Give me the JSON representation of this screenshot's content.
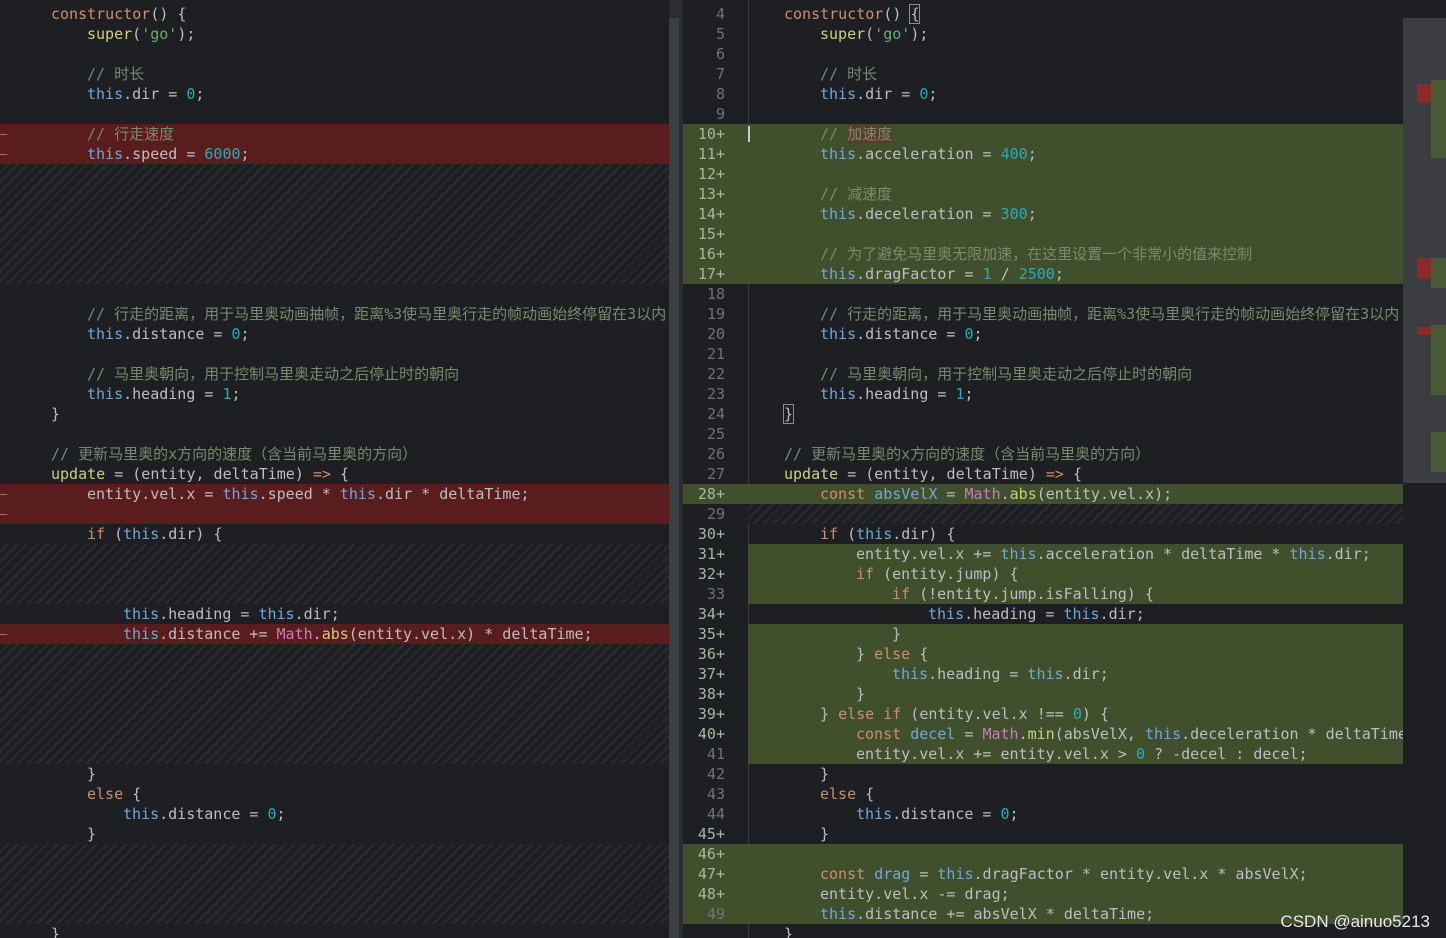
{
  "left": {
    "l1": {
      "kw": "constructor",
      "p": "() {"
    },
    "l2": {
      "f": "super",
      "o": "(",
      "s": "'go'",
      "e": ");"
    },
    "l4": "// 时长",
    "l5": {
      "t": "this",
      "m": ".dir = ",
      "n": "0",
      "e": ";"
    },
    "l7": "// 行走速度",
    "l8": {
      "t": "this",
      "m": ".speed = ",
      "n": "6000",
      "e": ";"
    },
    "l10": "// 行走的距离，用于马里奥动画抽帧，距离%3使马里奥行走的帧动画始终停留在3以内",
    "l11": {
      "t": "this",
      "m": ".distance = ",
      "n": "0",
      "e": ";"
    },
    "l13": "// 马里奥朝向，用于控制马里奥走动之后停止时的朝向",
    "l14": {
      "t": "this",
      "m": ".heading = ",
      "n": "1",
      "e": ";"
    },
    "l15": "}",
    "l17": "// 更新马里奥的x方向的速度（含当前马里奥的方向）",
    "l18": {
      "f": "update",
      "m": " = (entity, deltaTime) ",
      "a": "=>",
      "e": " {"
    },
    "l19": {
      "a": "entity.vel.x = ",
      "t1": "this",
      "b": ".speed * ",
      "t2": "this",
      "c": ".dir * deltaTime;"
    },
    "l21": {
      "k": "if",
      "a": " (",
      "t": "this",
      "b": ".dir) {"
    },
    "l22": {
      "t1": "this",
      "a": ".heading = ",
      "t2": "this",
      "b": ".dir;"
    },
    "l23": {
      "t": "this",
      "a": ".distance += ",
      "m": "Math",
      "b": ".",
      "f": "abs",
      "c": "(entity.vel.x) * deltaTime;"
    },
    "l24": "}",
    "l25": {
      "k": "else",
      "e": " {"
    },
    "l26": {
      "t": "this",
      "m": ".distance = ",
      "n": "0",
      "e": ";"
    },
    "l27": "}",
    "l28": "}"
  },
  "right": {
    "nums": [
      "4",
      "5",
      "6",
      "7",
      "8",
      "9",
      "10+",
      "11+",
      "12+",
      "13+",
      "14+",
      "15+",
      "16+",
      "17+",
      "18",
      "19",
      "20",
      "21",
      "22",
      "23",
      "24",
      "25",
      "26",
      "27",
      "28+",
      "29",
      "30+",
      "31+",
      "32+",
      "33",
      "34+",
      "35+",
      "36+",
      "37+",
      "38+",
      "39+",
      "40+",
      "41",
      "42",
      "43",
      "44",
      "45+",
      "46+",
      "47+",
      "48+",
      "49"
    ],
    "r1": {
      "kw": "constructor",
      "p": "() ",
      "b": "{"
    },
    "r2": {
      "f": "super",
      "o": "(",
      "s": "'go'",
      "e": ");"
    },
    "r4": "// 时长",
    "r5": {
      "t": "this",
      "m": ".dir = ",
      "n": "0",
      "e": ";"
    },
    "r7": {
      "c": "// ",
      "hl": "加速度"
    },
    "r8": {
      "t": "this",
      "m": ".acceleration = ",
      "n": "400",
      "e": ";"
    },
    "r10": "// 减速度",
    "r11": {
      "t": "this",
      "m": ".deceleration = ",
      "n": "300",
      "e": ";"
    },
    "r13": "// 为了避免马里奥无限加速，在这里设置一个非常小的值来控制",
    "r14": {
      "t": "this",
      "m": ".dragFactor = ",
      "n1": "1",
      "d": " / ",
      "n2": "2500",
      "e": ";"
    },
    "r16": "// 行走的距离，用于马里奥动画抽帧，距离%3使马里奥行走的帧动画始终停留在3以内",
    "r17": {
      "t": "this",
      "m": ".distance = ",
      "n": "0",
      "e": ";"
    },
    "r19": "// 马里奥朝向，用于控制马里奥走动之后停止时的朝向",
    "r20": {
      "t": "this",
      "m": ".heading = ",
      "n": "1",
      "e": ";"
    },
    "r21": "}",
    "r23": "// 更新马里奥的x方向的速度（含当前马里奥的方向）",
    "r24": {
      "f": "update",
      "m": " = (entity, deltaTime) ",
      "a": "=>",
      "e": " {"
    },
    "r25": {
      "k": "const ",
      "v": "absVelX",
      "a": " = ",
      "m": "Math",
      "b": ".",
      "f": "abs",
      "c": "(entity.vel.x);"
    },
    "r26": {
      "k": "if",
      "a": " (",
      "t": "this",
      "b": ".dir) {"
    },
    "r27": {
      "a": "entity.vel.x += ",
      "t1": "this",
      "b": ".acceleration * deltaTime * ",
      "t2": "this",
      "c": ".dir;"
    },
    "r28": {
      "k": "if",
      "a": " (entity.jump) {"
    },
    "r29": {
      "k": "if",
      "a": " (!entity.jump.isFalling) {"
    },
    "r30": {
      "t1": "this",
      "a": ".heading = ",
      "t2": "this",
      "b": ".dir;"
    },
    "r31": "}",
    "r32": {
      "a": "} ",
      "k": "else",
      "e": " {"
    },
    "r33": {
      "t1": "this",
      "a": ".heading = ",
      "t2": "this",
      "b": ".dir;"
    },
    "r34": "}",
    "r35": {
      "a": "} ",
      "k1": "else",
      "b": " ",
      "k2": "if",
      "c": " (entity.vel.x !== ",
      "n": "0",
      "e": ") {"
    },
    "r36": {
      "k": "const ",
      "v": "decel",
      "a": " = ",
      "m": "Math",
      "b": ".",
      "f": "min",
      "c": "(absVelX, ",
      "t": "this",
      "d": ".deceleration * deltaTime)"
    },
    "r37": {
      "a": "entity.vel.x += entity.vel.x > ",
      "n": "0",
      "b": " ? -decel : decel;"
    },
    "r38": "}",
    "r39": {
      "k": "else",
      "e": " {"
    },
    "r40": {
      "t": "this",
      "m": ".distance = ",
      "n": "0",
      "e": ";"
    },
    "r41": "}",
    "r43": {
      "k": "const ",
      "v": "drag",
      "a": " = ",
      "t": "this",
      "b": ".dragFactor * entity.vel.x * absVelX;"
    },
    "r44": "entity.vel.x -= drag;",
    "r45": {
      "t": "this",
      "a": ".distance += absVelX * deltaTime;"
    },
    "r46": "}"
  },
  "gutter_markers": {
    "deleted": "–"
  },
  "colors": {
    "deleted_bg": "#5a1d1d",
    "added_bg": "#40502c",
    "editor_bg": "#1e1f22"
  },
  "watermark": "CSDN @ainuo5213"
}
